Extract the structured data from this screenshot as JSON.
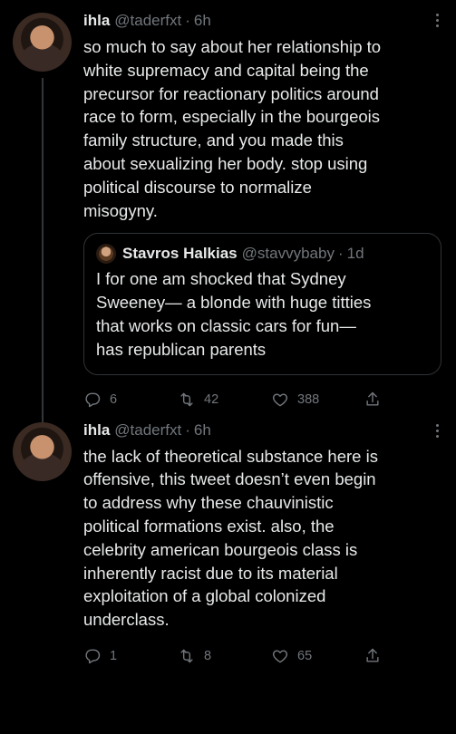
{
  "tweets": [
    {
      "name": "ihla",
      "handle": "@taderfxt",
      "separator": "·",
      "time": "6h",
      "text": "so much to say about her relationship to\nwhite supremacy and capital being the\nprecursor for reactionary politics around\nrace to form, especially in the bourgeois\nfamily structure, and you made this\nabout sexualizing her body. stop using\npolitical discourse to normalize\nmisogyny.",
      "quote": {
        "name": "Stavros Halkias",
        "handle": "@stavvybaby",
        "separator": "·",
        "time": "1d",
        "text": "I for one am shocked that Sydney\nSweeney— a blonde with huge titties\nthat works on classic cars for fun—\nhas republican parents"
      },
      "replies": "6",
      "retweets": "42",
      "likes": "388"
    },
    {
      "name": "ihla",
      "handle": "@taderfxt",
      "separator": "·",
      "time": "6h",
      "text": "the lack of theoretical substance here is\noffensive, this tweet doesn’t even begin\nto address why these chauvinistic\npolitical formations exist. also, the\ncelebrity american bourgeois class is\ninherently racist due to its material\nexploitation of a global colonized\nunderclass.",
      "replies": "1",
      "retweets": "8",
      "likes": "65"
    }
  ],
  "icons": {
    "reply": "reply-icon",
    "retweet": "retweet-icon",
    "like": "like-icon",
    "share": "share-icon",
    "more": "more-icon"
  },
  "colors": {
    "background": "#000000",
    "text": "#e7e9ea",
    "muted": "#71767b",
    "border": "#2f3336"
  }
}
